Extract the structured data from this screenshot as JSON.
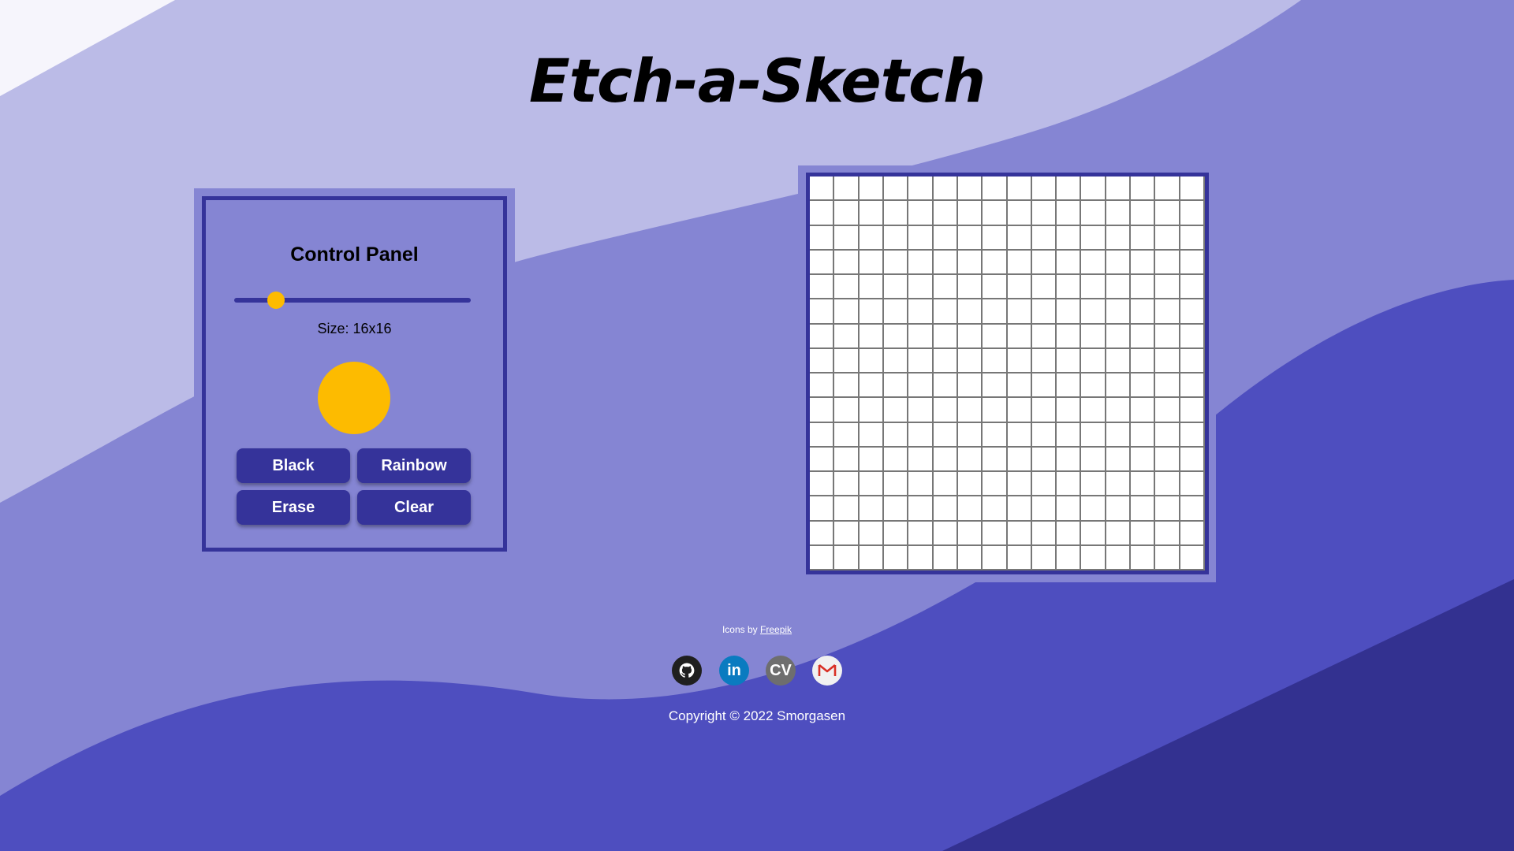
{
  "page": {
    "title": "Etch-a-Sketch"
  },
  "colors": {
    "bg_light": "#f6f5fc",
    "bg_lavender": "#bbbbe7",
    "bg_medium": "#8585d3",
    "bg_blue": "#4e4ebf",
    "bg_dark": "#333190",
    "panel_border": "#35339a",
    "accent_yellow": "#fdbb00"
  },
  "control_panel": {
    "title": "Control Panel",
    "size_label": "Size: 16x16",
    "slider_value": 16,
    "current_color": "#fdbb00",
    "buttons": {
      "black": "Black",
      "rainbow": "Rainbow",
      "erase": "Erase",
      "clear": "Clear"
    }
  },
  "grid": {
    "rows": 16,
    "columns": 16
  },
  "footer": {
    "credits_prefix": "Icons by",
    "credits_link": "Freepik",
    "socials": [
      {
        "name": "github",
        "icon": "github-icon"
      },
      {
        "name": "linkedin",
        "icon": "linkedin-icon",
        "glyph": "in"
      },
      {
        "name": "cv",
        "icon": "cv-icon",
        "glyph": "CV"
      },
      {
        "name": "gmail",
        "icon": "gmail-icon"
      }
    ],
    "copyright": "Copyright © 2022 Smorgasen"
  }
}
